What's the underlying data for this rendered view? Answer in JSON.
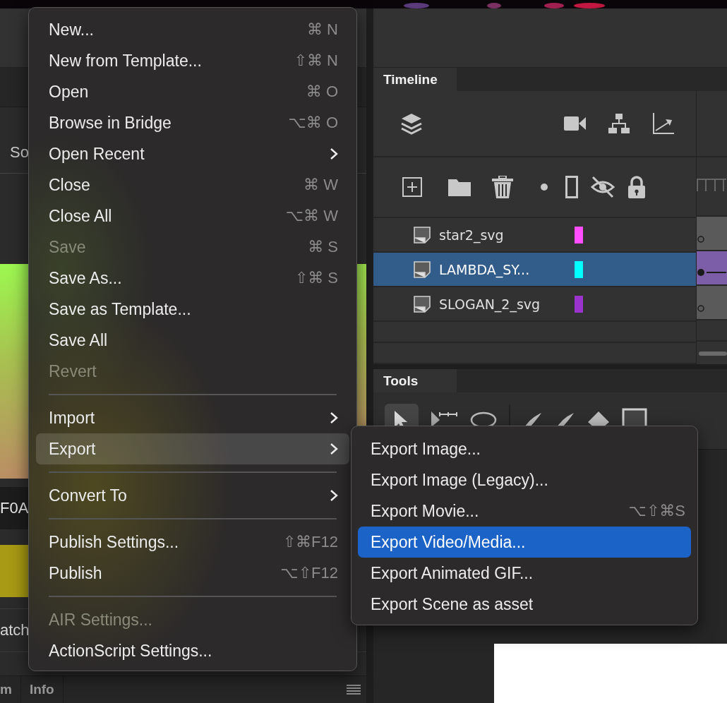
{
  "left_panel": {
    "section_label": "So",
    "color_value": "F0A",
    "swatch_label": "atch"
  },
  "bottom_tabs": [
    {
      "label": "m"
    },
    {
      "label": "Info"
    }
  ],
  "timeline": {
    "title": "Timeline",
    "layers": [
      {
        "name": "star2_svg",
        "color": "#ff4dff",
        "selected": false
      },
      {
        "name": "LAMBDA_SY...",
        "color": "#00ffff",
        "selected": true
      },
      {
        "name": "SLOGAN_2_svg",
        "color": "#9933cc",
        "selected": false
      }
    ]
  },
  "tools": {
    "title": "Tools"
  },
  "menu": {
    "items": [
      {
        "kind": "item",
        "label": "New...",
        "shortcut": "⌘ N",
        "submenu": false,
        "disabled": false,
        "selected": false
      },
      {
        "kind": "item",
        "label": "New from Template...",
        "shortcut": "⇧⌘ N",
        "submenu": false,
        "disabled": false,
        "selected": false
      },
      {
        "kind": "item",
        "label": "Open",
        "shortcut": "⌘ O",
        "submenu": false,
        "disabled": false,
        "selected": false
      },
      {
        "kind": "item",
        "label": "Browse in Bridge",
        "shortcut": "⌥⌘ O",
        "submenu": false,
        "disabled": false,
        "selected": false
      },
      {
        "kind": "item",
        "label": "Open Recent",
        "submenu": true,
        "disabled": false,
        "selected": false
      },
      {
        "kind": "item",
        "label": "Close",
        "shortcut": "⌘ W",
        "submenu": false,
        "disabled": false,
        "selected": false
      },
      {
        "kind": "item",
        "label": "Close All",
        "shortcut": "⌥⌘ W",
        "submenu": false,
        "disabled": false,
        "selected": false
      },
      {
        "kind": "item",
        "label": "Save",
        "shortcut": "⌘ S",
        "submenu": false,
        "disabled": true,
        "selected": false
      },
      {
        "kind": "item",
        "label": "Save As...",
        "shortcut": "⇧⌘ S",
        "submenu": false,
        "disabled": false,
        "selected": false
      },
      {
        "kind": "item",
        "label": "Save as Template...",
        "submenu": false,
        "disabled": false,
        "selected": false
      },
      {
        "kind": "item",
        "label": "Save All",
        "submenu": false,
        "disabled": false,
        "selected": false
      },
      {
        "kind": "item",
        "label": "Revert",
        "submenu": false,
        "disabled": true,
        "selected": false
      },
      {
        "kind": "separator"
      },
      {
        "kind": "item",
        "label": "Import",
        "submenu": true,
        "disabled": false,
        "selected": false
      },
      {
        "kind": "item",
        "label": "Export",
        "submenu": true,
        "disabled": false,
        "selected": true
      },
      {
        "kind": "separator"
      },
      {
        "kind": "item",
        "label": "Convert To",
        "submenu": true,
        "disabled": false,
        "selected": false
      },
      {
        "kind": "separator"
      },
      {
        "kind": "item",
        "label": "Publish Settings...",
        "shortcut": "⇧⌘F12",
        "submenu": false,
        "disabled": false,
        "selected": false
      },
      {
        "kind": "item",
        "label": "Publish",
        "shortcut": "⌥⇧F12",
        "submenu": false,
        "disabled": false,
        "selected": false
      },
      {
        "kind": "separator"
      },
      {
        "kind": "item",
        "label": "AIR Settings...",
        "submenu": false,
        "disabled": true,
        "selected": false
      },
      {
        "kind": "item",
        "label": "ActionScript Settings...",
        "submenu": false,
        "disabled": false,
        "selected": false
      }
    ]
  },
  "submenu": {
    "items": [
      {
        "label": "Export Image...",
        "selected": false
      },
      {
        "label": "Export Image (Legacy)...",
        "selected": false
      },
      {
        "label": "Export Movie...",
        "shortcut": "⌥⇧⌘S",
        "selected": false
      },
      {
        "label": "Export Video/Media...",
        "selected": true
      },
      {
        "label": "Export Animated GIF...",
        "selected": false
      },
      {
        "label": "Export Scene as asset",
        "selected": false
      }
    ]
  }
}
